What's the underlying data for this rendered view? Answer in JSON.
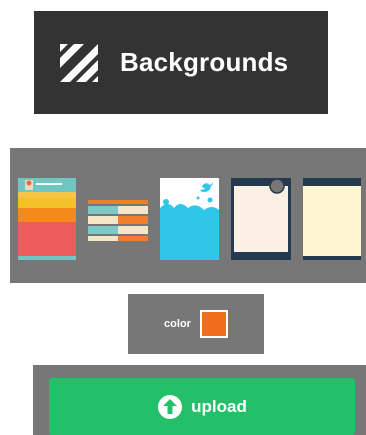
{
  "header": {
    "title": "Backgrounds",
    "icon": "diagonal-stripes-icon"
  },
  "backgrounds": {
    "items": [
      {
        "name": "thumb-profile-card",
        "selected": false
      },
      {
        "name": "thumb-stacked-rows",
        "selected": false
      },
      {
        "name": "thumb-twitter-clouds",
        "selected": false
      },
      {
        "name": "thumb-dark-frame",
        "selected": false
      },
      {
        "name": "thumb-notepad",
        "selected": false
      }
    ]
  },
  "color": {
    "label": "color",
    "value": "#f26d1a"
  },
  "upload": {
    "label": "upload",
    "icon": "arrow-up-circle-icon",
    "color": "#22c068"
  }
}
